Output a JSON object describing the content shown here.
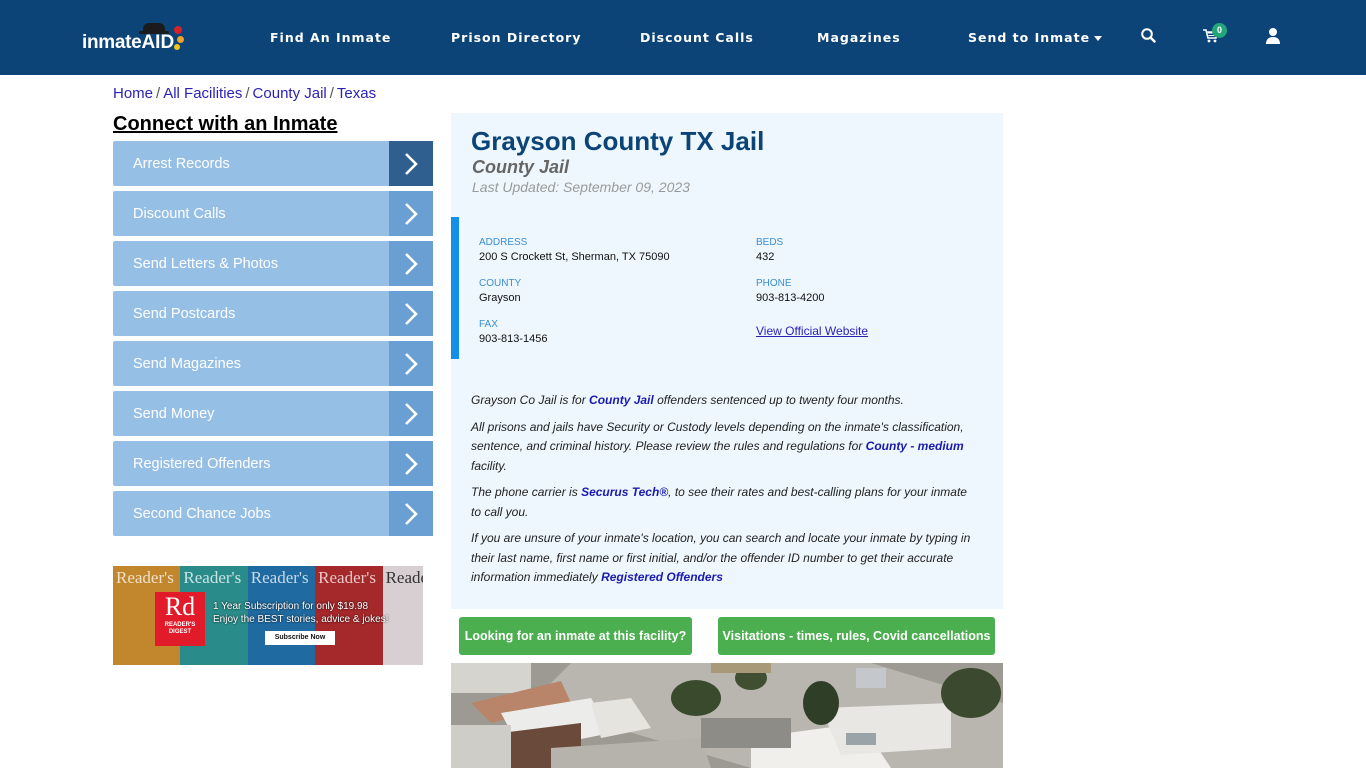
{
  "header": {
    "logo_text": "inmate",
    "logo_accent": "AID",
    "nav": [
      {
        "label": "Find An Inmate"
      },
      {
        "label": "Prison Directory"
      },
      {
        "label": "Discount Calls"
      },
      {
        "label": "Magazines"
      },
      {
        "label": "Send to Inmate",
        "has_dropdown": true
      }
    ],
    "icons": [
      "search-icon",
      "cart-icon",
      "user-icon"
    ],
    "cart_count": "0",
    "colors": {
      "bar": "#0c4477",
      "badge": "#22a67a"
    }
  },
  "breadcrumb": [
    {
      "label": "Home"
    },
    {
      "label": "All Facilities"
    },
    {
      "label": "County Jail"
    },
    {
      "label": "Texas"
    }
  ],
  "sidebar": {
    "title": "Connect with an Inmate",
    "items": [
      {
        "label": "Arrest Records",
        "active": true
      },
      {
        "label": "Discount Calls"
      },
      {
        "label": "Send Letters & Photos"
      },
      {
        "label": "Send Postcards"
      },
      {
        "label": "Send Magazines"
      },
      {
        "label": "Send Money"
      },
      {
        "label": "Registered Offenders"
      },
      {
        "label": "Second Chance Jobs"
      }
    ],
    "ad": {
      "brand_mark": "Rd",
      "brand_name": "READER'S DIGEST",
      "cover_title": "Reader's",
      "line1": "1 Year Subscription for only $19.98",
      "line2": "Enjoy the BEST stories, advice & jokes!",
      "cta": "Subscribe Now"
    }
  },
  "facility": {
    "name": "Grayson County TX Jail",
    "type": "County Jail",
    "last_updated": "Last Updated: September 09, 2023",
    "fields": {
      "address": {
        "label": "ADDRESS",
        "value": "200 S Crockett St, Sherman, TX 75090"
      },
      "beds": {
        "label": "BEDS",
        "value": "432"
      },
      "county": {
        "label": "COUNTY",
        "value": "Grayson"
      },
      "phone": {
        "label": "PHONE",
        "value": "903-813-4200"
      },
      "fax": {
        "label": "FAX",
        "value": "903-813-1456"
      }
    },
    "website_link": "View Official Website",
    "paragraphs": {
      "p1_a": "Grayson Co Jail is for ",
      "p1_link": "County Jail",
      "p1_b": " offenders sentenced up to twenty four months.",
      "p2_a": "All prisons and jails have Security or Custody levels depending on the inmate's classification, sentence, and criminal history. Please review the rules and regulations for ",
      "p2_link": "County - medium",
      "p2_b": " facility.",
      "p3_a": "The phone carrier is ",
      "p3_link": "Securus Tech®",
      "p3_b": ", to see their rates and best-calling plans for your inmate to call you.",
      "p4_a": "If you are unsure of your inmate's location, you can search and locate your inmate by typing in their last name, first name or first initial, and/or the offender ID number to get their accurate information immediately ",
      "p4_link": "Registered Offenders"
    }
  },
  "actions": {
    "find_inmate": "Looking for an inmate at this facility?",
    "visitation": "Visitations - times, rules, Covid cancellations"
  }
}
